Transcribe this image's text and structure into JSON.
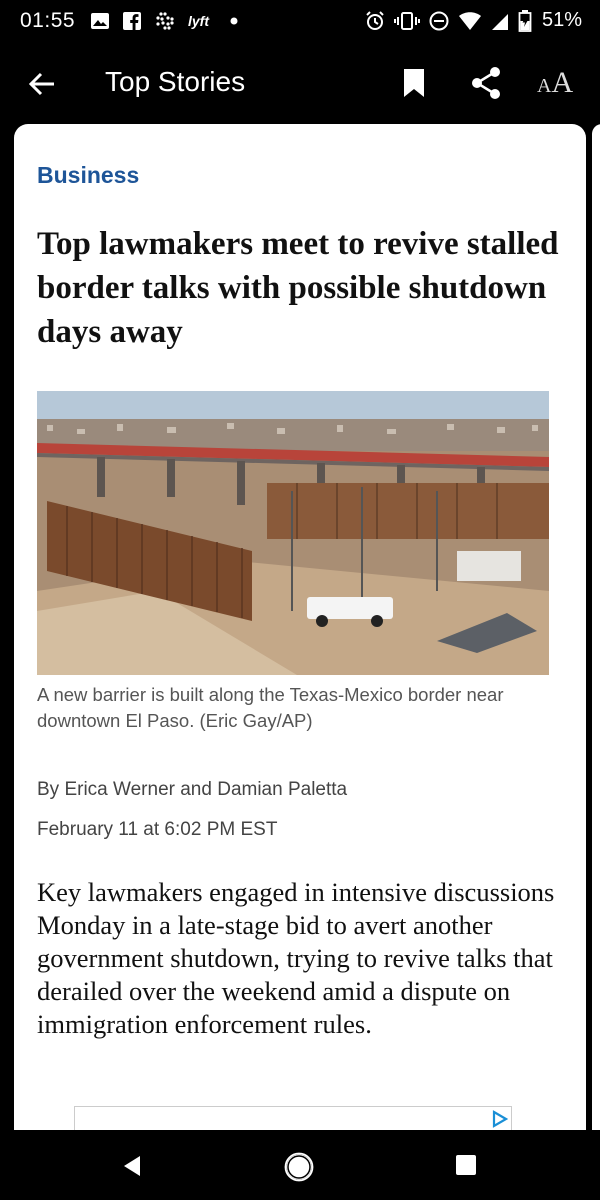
{
  "status_bar": {
    "time": "01:55",
    "battery": "51%",
    "left_icons": [
      "image-icon",
      "facebook-icon",
      "slack-icon",
      "lyft-icon",
      "dot-icon"
    ],
    "lyft_text": "lyft",
    "right_icons": [
      "alarm-icon",
      "vibrate-icon",
      "dnd-icon",
      "wifi-icon",
      "signal-icon",
      "battery-icon"
    ]
  },
  "app_bar": {
    "title": "Top Stories",
    "text_size_small": "A",
    "text_size_big": "A"
  },
  "article": {
    "section": "Business",
    "headline": "Top lawmakers meet to revive stalled border talks with possible shutdown days away",
    "caption": "A new barrier is built along the Texas-Mexico border near downtown El Paso. (Eric Gay/AP)",
    "byline": "By Erica Werner and Damian Paletta",
    "date": "February 11 at 6:02 PM EST",
    "body": "Key lawmakers engaged in intensive discussions Monday in a late-stage bid to avert another government shutdown, trying to revive talks that derailed over the weekend amid a dispute on immigration enforcement rules."
  },
  "colors": {
    "section_blue": "#1e5598",
    "background": "#000000",
    "card": "#ffffff"
  }
}
